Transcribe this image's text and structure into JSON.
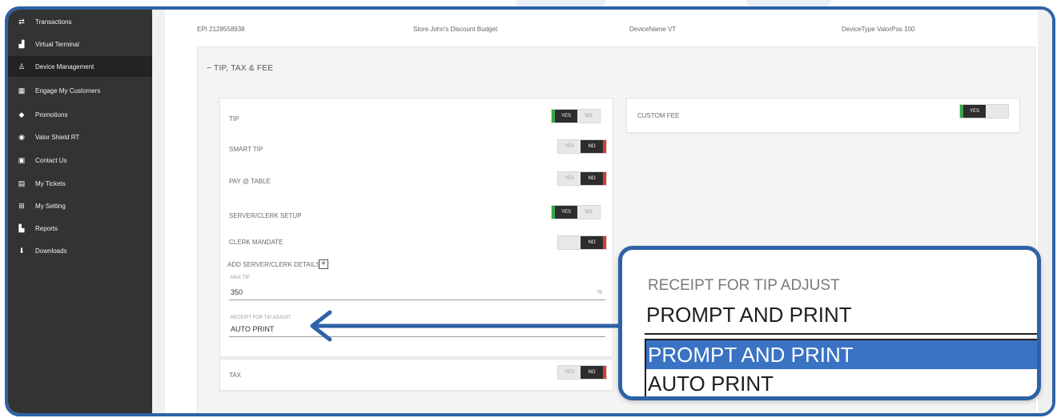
{
  "sidebar": {
    "items": [
      {
        "label": "Transactions",
        "icon": "swap-icon"
      },
      {
        "label": "Virtual Terminal",
        "icon": "terminal-icon"
      },
      {
        "label": "Device Management",
        "icon": "device-icon"
      },
      {
        "label": "Engage My Customers",
        "icon": "grid-icon"
      },
      {
        "label": "Promotions",
        "icon": "tag-icon"
      },
      {
        "label": "Valor Shield RT",
        "icon": "shield-icon"
      },
      {
        "label": "Contact Us",
        "icon": "contact-icon"
      },
      {
        "label": "My Tickets",
        "icon": "ticket-icon"
      },
      {
        "label": "My Setting",
        "icon": "settings-icon"
      },
      {
        "label": "Reports",
        "icon": "report-icon"
      },
      {
        "label": "Downloads",
        "icon": "download-icon"
      }
    ],
    "active_index": 2
  },
  "info": {
    "epi": "EPI 2128558938",
    "store": "Store John's Discount Budget",
    "device_name": "DeviceName VT",
    "device_type": "DeviceType ValorPos 100"
  },
  "section": {
    "title": "TIP, TAX & FEE"
  },
  "rows": {
    "tip": {
      "label": "TIP",
      "yes": "YES",
      "no": "NO",
      "value": "yes"
    },
    "smart_tip": {
      "label": "SMART TIP",
      "yes": "YES",
      "no": "NO",
      "value": "no"
    },
    "pay_table": {
      "label": "PAY @ TABLE",
      "yes": "YES",
      "no": "NO",
      "value": "no"
    },
    "server_clerk": {
      "label": "SERVER/CLERK SETUP",
      "yes": "YES",
      "no": "NO",
      "value": "yes"
    },
    "clerk_mandate": {
      "label": "CLERK MANDATE",
      "yes": "",
      "no": "NO",
      "value": "no"
    },
    "add_server": {
      "label": "ADD SERVER/CLERK DETAILS"
    },
    "tax": {
      "label": "TAX",
      "yes": "YES",
      "no": "NO",
      "value": "no"
    },
    "custom_fee": {
      "label": "CUSTOM FEE",
      "yes": "YES",
      "no": "",
      "value": "yes"
    }
  },
  "max_tip": {
    "label": "MAX TIP",
    "value": "350",
    "unit": "%"
  },
  "receipt_tip": {
    "label": "RECEIPT FOR TIP ADJUST",
    "value": "AUTO PRINT"
  },
  "callout": {
    "label": "RECEIPT FOR TIP ADJUST",
    "value": "PROMPT AND PRINT",
    "options": [
      "PROMPT AND PRINT",
      "AUTO PRINT"
    ],
    "selected_index": 0
  },
  "colors": {
    "accent_blue": "#2e62a6",
    "yes_green": "#39a64a",
    "no_red": "#d8393b",
    "sidebar_bg": "#333333",
    "selected_option": "#3a72c4"
  }
}
